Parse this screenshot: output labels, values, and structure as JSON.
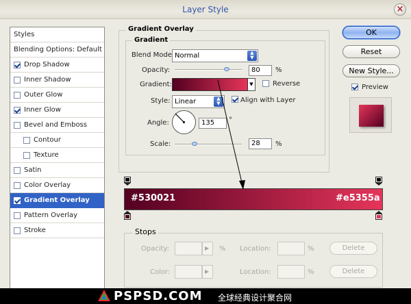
{
  "window": {
    "title": "Layer Style"
  },
  "sidebar": {
    "items": [
      {
        "label": "Styles",
        "checkbox": false,
        "checked": false,
        "selected": false,
        "indent": false
      },
      {
        "label": "Blending Options: Default",
        "checkbox": false,
        "checked": false,
        "selected": false,
        "indent": false
      },
      {
        "label": "Drop Shadow",
        "checkbox": true,
        "checked": true,
        "selected": false,
        "indent": false
      },
      {
        "label": "Inner Shadow",
        "checkbox": true,
        "checked": false,
        "selected": false,
        "indent": false
      },
      {
        "label": "Outer Glow",
        "checkbox": true,
        "checked": false,
        "selected": false,
        "indent": false
      },
      {
        "label": "Inner Glow",
        "checkbox": true,
        "checked": true,
        "selected": false,
        "indent": false
      },
      {
        "label": "Bevel and Emboss",
        "checkbox": true,
        "checked": false,
        "selected": false,
        "indent": false
      },
      {
        "label": "Contour",
        "checkbox": true,
        "checked": false,
        "selected": false,
        "indent": true
      },
      {
        "label": "Texture",
        "checkbox": true,
        "checked": false,
        "selected": false,
        "indent": true
      },
      {
        "label": "Satin",
        "checkbox": true,
        "checked": false,
        "selected": false,
        "indent": false
      },
      {
        "label": "Color Overlay",
        "checkbox": true,
        "checked": false,
        "selected": false,
        "indent": false
      },
      {
        "label": "Gradient Overlay",
        "checkbox": true,
        "checked": true,
        "selected": true,
        "indent": false
      },
      {
        "label": "Pattern Overlay",
        "checkbox": true,
        "checked": false,
        "selected": false,
        "indent": false
      },
      {
        "label": "Stroke",
        "checkbox": true,
        "checked": false,
        "selected": false,
        "indent": false
      }
    ]
  },
  "panel": {
    "title": "Gradient Overlay",
    "group_title": "Gradient",
    "blend_mode": {
      "label": "Blend Mode:",
      "value": "Normal"
    },
    "opacity": {
      "label": "Opacity:",
      "value": "80",
      "unit": "%",
      "level": 0.8
    },
    "gradient": {
      "label": "Gradient:",
      "reverse_label": "Reverse",
      "reverse_checked": false
    },
    "style": {
      "label": "Style:",
      "value": "Linear",
      "align_label": "Align with Layer",
      "align_checked": true
    },
    "angle": {
      "label": "Angle:",
      "value": "135",
      "unit": "°"
    },
    "scale": {
      "label": "Scale:",
      "value": "28",
      "unit": "%",
      "level": 0.28
    }
  },
  "buttons": {
    "ok": "OK",
    "reset": "Reset",
    "new_style": "New Style...",
    "preview": "Preview",
    "preview_checked": true
  },
  "gradient_editor": {
    "left_color": "#530021",
    "right_color": "#e5355a",
    "left_label": "#530021",
    "right_label": "#e5355a"
  },
  "stops": {
    "title": "Stops",
    "opacity_label": "Opacity:",
    "color_label": "Color:",
    "location_label": "Location:",
    "percent": "%",
    "delete_label": "Delete"
  },
  "watermark": {
    "brand": "PSPSD.COM",
    "tagline": "全球经典设计聚合网"
  }
}
